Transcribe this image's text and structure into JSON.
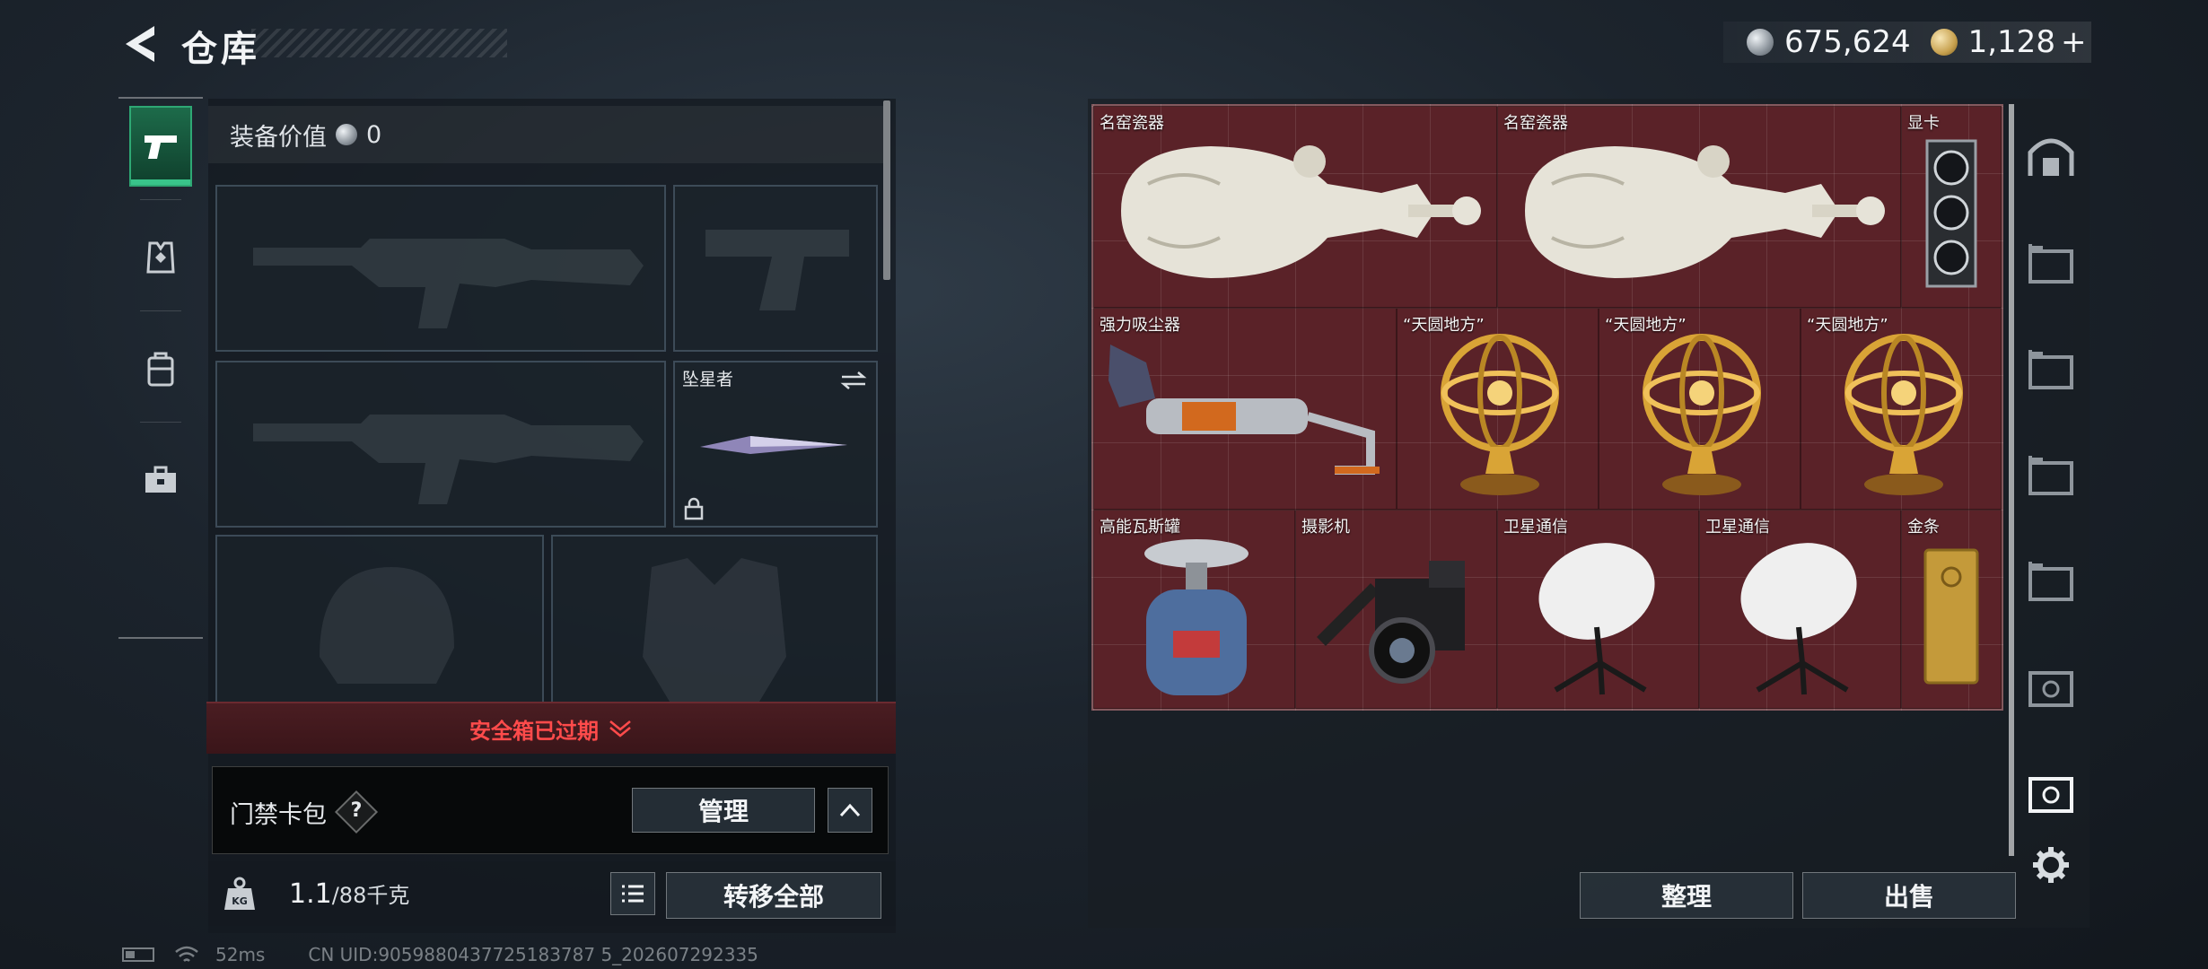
{
  "header": {
    "title": "仓库",
    "currencies": [
      {
        "icon": "silver-coin-icon",
        "value": "675,624"
      },
      {
        "icon": "gold-coin-icon",
        "value": "1,128",
        "suffix": "+"
      }
    ]
  },
  "loadout": {
    "equipment_value_label": "装备价值",
    "equipment_value": "0",
    "melee_label": "坠星者",
    "secure_box_status": "安全箱已过期",
    "keycard_label": "门禁卡包",
    "help_symbol": "?",
    "manage_button": "管理",
    "weight_current": "1.1",
    "weight_capacity": "/88千克",
    "weight_icon_text": "KG",
    "transfer_all_button": "转移全部"
  },
  "storage": {
    "items": [
      {
        "label": "名窑瓷器",
        "icon": "porcelain-vase-icon"
      },
      {
        "label": "名窑瓷器",
        "icon": "porcelain-vase-icon"
      },
      {
        "label": "显卡",
        "icon": "graphics-card-icon"
      },
      {
        "label": "强力吸尘器",
        "icon": "vacuum-cleaner-icon"
      },
      {
        "label": "“天圆地方”",
        "icon": "armillary-sphere-icon"
      },
      {
        "label": "“天圆地方”",
        "icon": "armillary-sphere-icon"
      },
      {
        "label": "“天圆地方”",
        "icon": "armillary-sphere-icon"
      },
      {
        "label": "高能瓦斯罐",
        "icon": "gas-canister-icon"
      },
      {
        "label": "摄影机",
        "icon": "video-camera-icon"
      },
      {
        "label": "卫星通信",
        "icon": "satellite-dish-icon"
      },
      {
        "label": "卫星通信",
        "icon": "satellite-dish-icon"
      },
      {
        "label": "金条",
        "icon": "gold-bar-icon"
      }
    ],
    "sort_button": "整理",
    "sell_button": "出售"
  },
  "footer": {
    "ping": "52ms",
    "uid": "CN UID:9059880437725183787 5_202607292335"
  },
  "colors": {
    "grid_bg": "#5a2228",
    "alert_red": "#ff4b4b",
    "active_tab": "#2ea874"
  }
}
